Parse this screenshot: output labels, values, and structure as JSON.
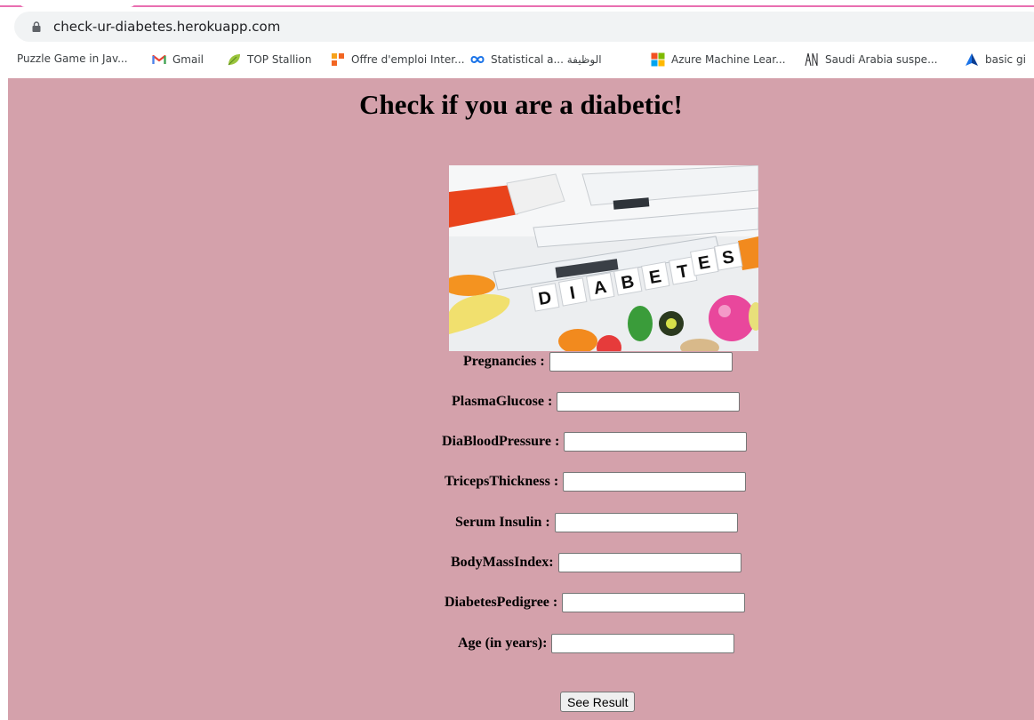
{
  "browser": {
    "url": "check-ur-diabetes.herokuapp.com",
    "bookmarks": [
      {
        "label": "Puzzle Game in Jav...",
        "icon": "none"
      },
      {
        "label": "Gmail",
        "icon": "gmail-icon"
      },
      {
        "label": "TOP Stallion",
        "icon": "leaf-icon"
      },
      {
        "label": "Offre d'emploi Inter...",
        "icon": "orange-flag-icon"
      },
      {
        "label": "Statistical a... الوظيفة",
        "icon": "infinity-icon"
      },
      {
        "label": "Azure Machine Lear...",
        "icon": "windows-grid-icon"
      },
      {
        "label": "Saudi Arabia suspe...",
        "icon": "an-logo-icon"
      },
      {
        "label": "basic gi",
        "icon": "triangle-icon"
      }
    ]
  },
  "page": {
    "title": "Check if you are a diabetic!",
    "image": {
      "letters": [
        "D",
        "I",
        "A",
        "B",
        "E",
        "T",
        "E",
        "S"
      ]
    },
    "fields": [
      {
        "label": "Pregnancies :",
        "value": ""
      },
      {
        "label": "PlasmaGlucose :",
        "value": ""
      },
      {
        "label": "DiaBloodPressure :",
        "value": ""
      },
      {
        "label": "TricepsThickness :",
        "value": ""
      },
      {
        "label": "Serum Insulin :",
        "value": ""
      },
      {
        "label": "BodyMassIndex:",
        "value": ""
      },
      {
        "label": "DiabetesPedigree :",
        "value": ""
      },
      {
        "label": "Age (in years):",
        "value": ""
      }
    ],
    "submit_label": "See Result"
  },
  "colors": {
    "background": "#d4a1ab",
    "tab_accent": "#e96fb1"
  }
}
